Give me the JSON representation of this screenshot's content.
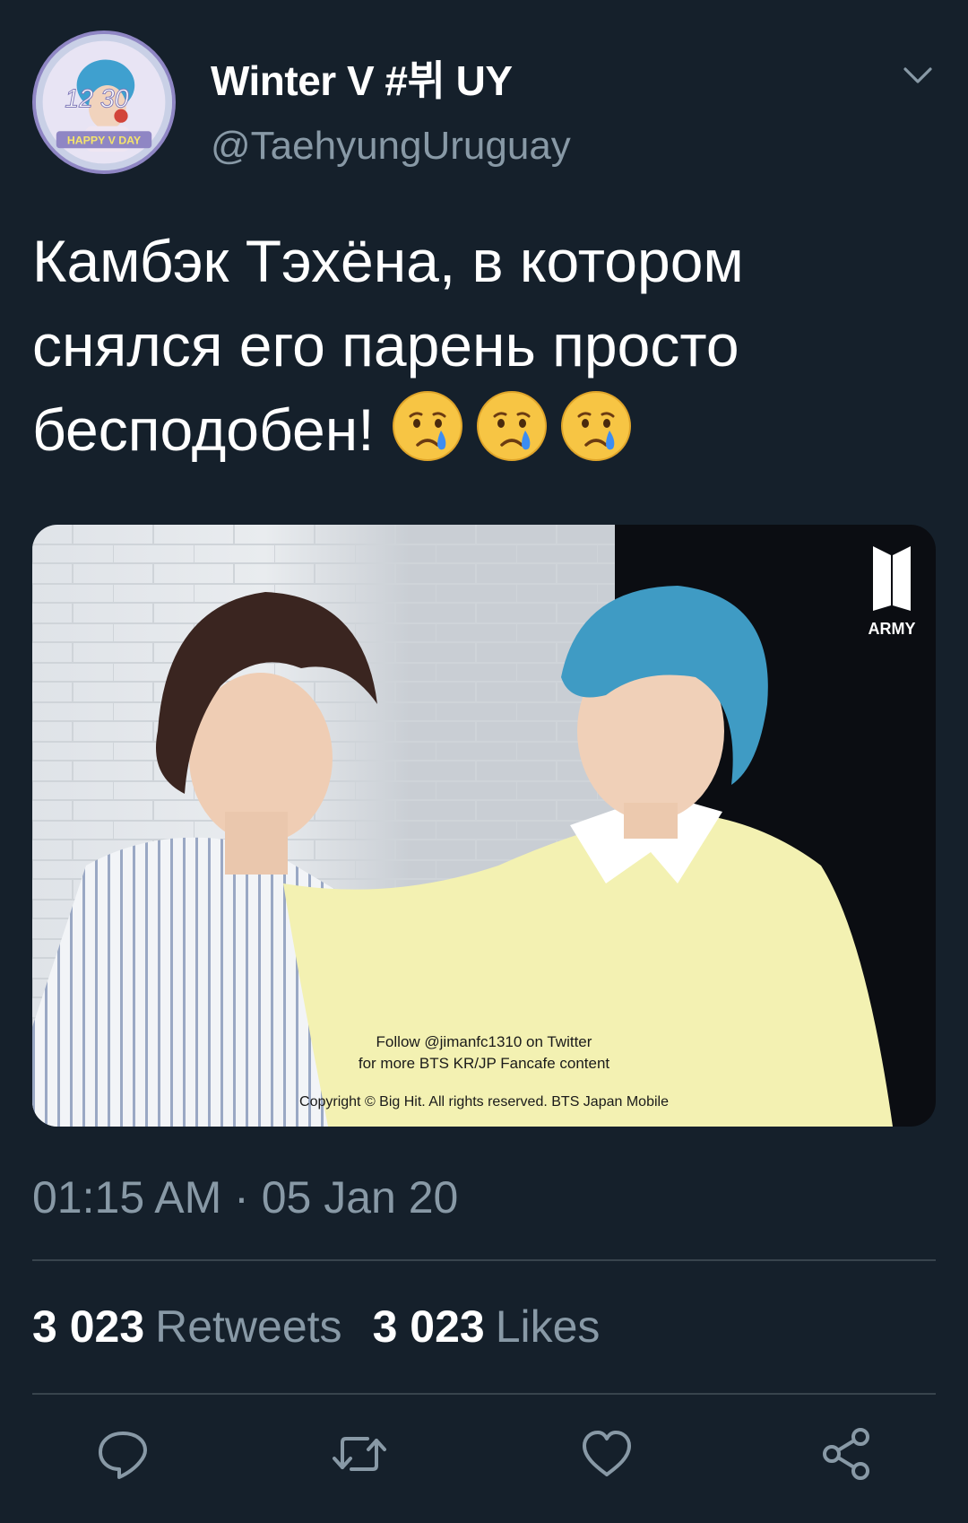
{
  "tweet": {
    "display_name": "Winter V #뷔 UY",
    "handle": "@TaehyungUruguay",
    "text": "Камбэк Тэхёна, в котором снялся его парень просто бесподобен!",
    "emojis": [
      "crying-face",
      "crying-face",
      "crying-face"
    ],
    "timestamp": "01:15 AM · 05 Jan 20",
    "avatar_text": {
      "top": "12 30",
      "banner": "HAPPY V DAY"
    },
    "media": {
      "watermark_logo": "ARMY",
      "caption_line1": "Follow @jimanfc1310 on Twitter",
      "caption_line2": "for more BTS KR/JP Fancafe content",
      "copyright": "Copyright © Big Hit. All rights reserved. BTS Japan Mobile"
    }
  },
  "stats": {
    "retweets_count": "3 023",
    "retweets_label": "Retweets",
    "likes_count": "3 023",
    "likes_label": "Likes"
  },
  "actions": [
    "reply-icon",
    "retweet-icon",
    "like-icon",
    "share-icon"
  ],
  "colors": {
    "background": "#15202b",
    "secondary_text": "#8899a6",
    "divider": "#38444d",
    "icon": "#8899a6"
  }
}
